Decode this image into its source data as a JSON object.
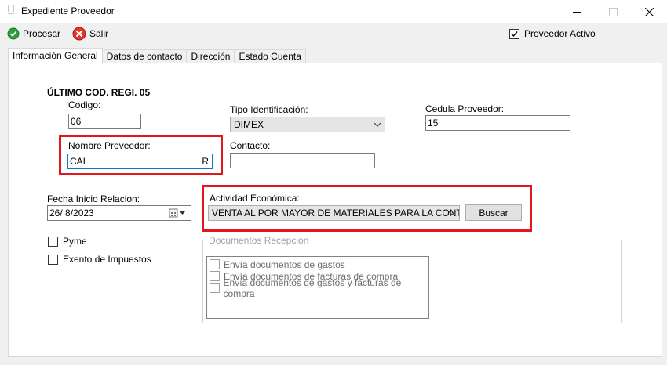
{
  "window": {
    "title": "Expediente Proveedor"
  },
  "toolbar": {
    "procesar_label": "Procesar",
    "salir_label": "Salir"
  },
  "proveedor_activo": {
    "label": "Proveedor Activo",
    "checked": true
  },
  "tabs": [
    {
      "label": "Información General"
    },
    {
      "label": "Datos de contacto"
    },
    {
      "label": "Dirección"
    },
    {
      "label": "Estado Cuenta"
    }
  ],
  "form": {
    "ultimo_cod": "ÚLTIMO COD. REGI. 05",
    "codigo_label": "Codigo:",
    "codigo_value": "06",
    "tipo_id_label": "Tipo Identificación:",
    "tipo_id_value": "DIMEX",
    "cedula_label": "Cedula Proveedor:",
    "cedula_value": "15",
    "nombre_label": "Nombre Proveedor:",
    "nombre_value": "CAI",
    "nombre_suffix": "R",
    "contacto_label": "Contacto:",
    "contacto_value": "",
    "fecha_label": "Fecha Inicio Relacion:",
    "fecha_value": "26/  8/2023",
    "actividad_label": "Actividad Económica:",
    "actividad_value": "VENTA AL POR MAYOR DE  MATERIALES PARA LA CONTR",
    "buscar_label": "Buscar",
    "pyme_label": "Pyme",
    "exento_label": "Exento de Impuestos"
  },
  "documentos": {
    "legend": "Documentos Recepción",
    "items": [
      {
        "label": "Envía documentos de gastos"
      },
      {
        "label": "Envía documentos de facturas de compra"
      },
      {
        "label": "Envía documentos de gastos y facturas de compra"
      }
    ]
  },
  "colors": {
    "highlight": "#e3161c",
    "accent_green": "#2e9e3e",
    "exit_red": "#e0362c"
  }
}
